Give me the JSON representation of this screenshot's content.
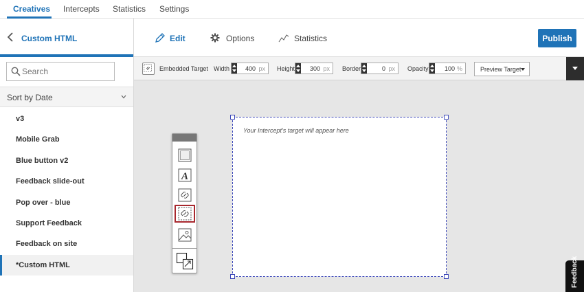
{
  "topnav": {
    "tabs": [
      {
        "label": "Creatives",
        "active": true
      },
      {
        "label": "Intercepts",
        "active": false
      },
      {
        "label": "Statistics",
        "active": false
      },
      {
        "label": "Settings",
        "active": false
      }
    ]
  },
  "sidebar": {
    "title": "Custom HTML",
    "search_placeholder": "Search",
    "sort_label": "Sort by Date",
    "items": [
      {
        "label": "v3"
      },
      {
        "label": "Mobile Grab"
      },
      {
        "label": "Blue button v2"
      },
      {
        "label": "Feedback slide-out"
      },
      {
        "label": "Pop over - blue"
      },
      {
        "label": "Support Feedback"
      },
      {
        "label": "Feedback on site"
      },
      {
        "label": "*Custom HTML",
        "selected": true
      }
    ]
  },
  "editor_header": {
    "tabs": [
      {
        "label": "Edit",
        "icon": "pencil-icon",
        "active": true
      },
      {
        "label": "Options",
        "icon": "gear-icon",
        "active": false
      },
      {
        "label": "Statistics",
        "icon": "line-chart-icon",
        "active": false
      }
    ],
    "publish_label": "Publish"
  },
  "toolbar": {
    "element_type": "Embedded Target",
    "width_label": "Width",
    "width_value": "400",
    "width_unit": "px",
    "height_label": "Height",
    "height_value": "300",
    "height_unit": "px",
    "border_label": "Border",
    "border_value": "0",
    "border_unit": "px",
    "opacity_label": "Opacity",
    "opacity_value": "100",
    "opacity_unit": "%",
    "preview_label": "Preview Target"
  },
  "canvas": {
    "target_hint": "Your Intercept's target will appear here"
  },
  "palette": {
    "tools": [
      "rectangle-tool-icon",
      "text-tool-icon",
      "link-tool-icon",
      "embedded-target-tool-icon",
      "image-tool-icon",
      "layer-order-icon"
    ],
    "selected_tool": "embedded-target-tool-icon"
  },
  "feedback_label": "Feedback",
  "colors": {
    "accent": "#1f73b7",
    "selection_border": "#3b47b8",
    "selected_tool_border": "#a8282e",
    "canvas_bg": "#e6e6e6"
  }
}
